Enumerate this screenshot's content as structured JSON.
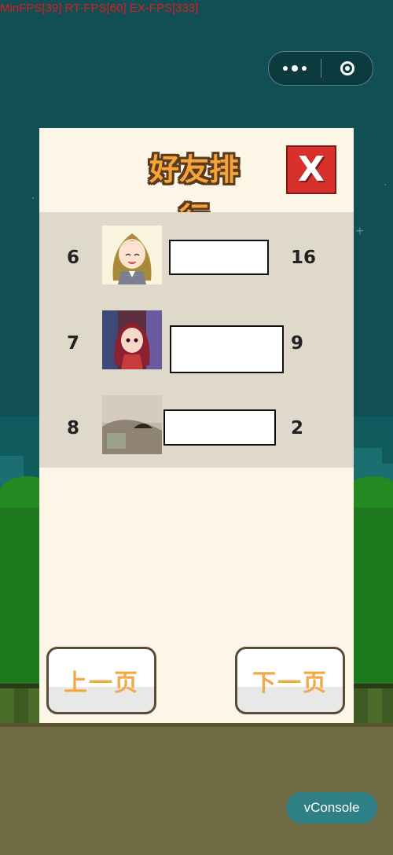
{
  "debug": {
    "fps_text": "MinFPS[39] RT-FPS[60] EX-FPS[333]"
  },
  "colors": {
    "accent": "#f5a33a",
    "panel_bg": "#fdf6e6",
    "list_bg": "#dfd9cb",
    "close_red": "#d8302a",
    "vconsole_bg": "#2f7f86"
  },
  "ranking": {
    "title": "好友排行",
    "close_label": "X",
    "rows": [
      {
        "rank": "6",
        "score": "16",
        "avatar_icon": "anime-girl-avatar"
      },
      {
        "rank": "7",
        "score": "9",
        "avatar_icon": "anime-character-avatar"
      },
      {
        "rank": "8",
        "score": "2",
        "avatar_icon": "photo-avatar"
      }
    ],
    "prev_label": "上一页",
    "next_label": "下一页"
  },
  "vconsole_label": "vConsole"
}
